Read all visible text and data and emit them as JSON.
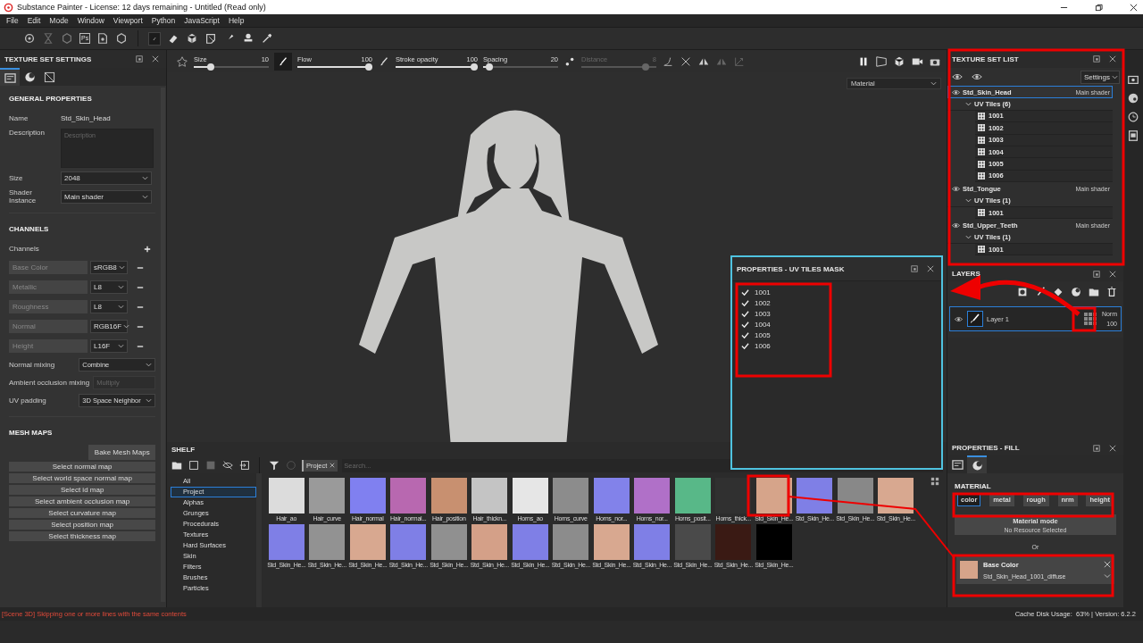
{
  "window": {
    "title": "Substance Painter - License: 12 days remaining - Untitled (Read only)"
  },
  "menu": [
    "File",
    "Edit",
    "Mode",
    "Window",
    "Viewport",
    "Python",
    "JavaScript",
    "Help"
  ],
  "toolbar": {
    "export_badge": "Ps"
  },
  "tool_options": {
    "sliders": [
      {
        "label": "Size",
        "value": "10",
        "level": 0.2,
        "disabled": false
      },
      {
        "label": "Flow",
        "value": "100",
        "level": 1,
        "disabled": false
      },
      {
        "label": "Stroke opacity",
        "value": "100",
        "level": 1,
        "disabled": false
      },
      {
        "label": "Spacing",
        "value": "20",
        "level": 0.04,
        "disabled": false
      },
      {
        "label": "Distance",
        "value": "8",
        "level": 0.9,
        "disabled": true
      }
    ]
  },
  "texture_set_settings": {
    "title": "TEXTURE SET SETTINGS",
    "tabs": [
      {
        "kind": "settings",
        "selected": true
      },
      {
        "kind": "material",
        "selected": false
      },
      {
        "kind": "uv",
        "selected": false
      }
    ],
    "general": {
      "heading": "GENERAL PROPERTIES",
      "name_label": "Name",
      "name_value": "Std_Skin_Head",
      "description_label": "Description",
      "description_placeholder": "Description",
      "size_label": "Size",
      "size_value": "2048",
      "shader_label": "Shader Instance",
      "shader_value": "Main shader"
    },
    "channels": {
      "heading": "CHANNELS",
      "label": "Channels",
      "items": [
        {
          "name": "Base Color",
          "format": "sRGB8"
        },
        {
          "name": "Metallic",
          "format": "L8"
        },
        {
          "name": "Roughness",
          "format": "L8"
        },
        {
          "name": "Normal",
          "format": "RGB16F"
        },
        {
          "name": "Height",
          "format": "L16F"
        }
      ],
      "normal_mixing_label": "Normal mixing",
      "normal_mixing_value": "Combine",
      "ao_mixing_label": "Ambient occlusion mixing",
      "ao_mixing_placeholder": "Multiply",
      "uv_padding_label": "UV padding",
      "uv_padding_value": "3D Space Neighbor"
    },
    "mesh_maps": {
      "heading": "MESH MAPS",
      "bake": "Bake Mesh Maps",
      "buttons": [
        "Select normal map",
        "Select world space normal map",
        "Select id map",
        "Select ambient occlusion map",
        "Select curvature map",
        "Select position map",
        "Select thickness map"
      ]
    }
  },
  "viewport": {
    "mode": "Material"
  },
  "uv_tiles_mask": {
    "title": "PROPERTIES - UV TILES MASK",
    "tiles": [
      {
        "label": "1001",
        "checked": true
      },
      {
        "label": "1002",
        "checked": true
      },
      {
        "label": "1003",
        "checked": true
      },
      {
        "label": "1004",
        "checked": true
      },
      {
        "label": "1005",
        "checked": true
      },
      {
        "label": "1006",
        "checked": true
      }
    ]
  },
  "shelf": {
    "title": "SHELF",
    "filter_tag": "Project",
    "search_placeholder": "Search...",
    "categories": [
      {
        "label": "All",
        "selected": false
      },
      {
        "label": "Project",
        "selected": true
      },
      {
        "label": "Alphas",
        "selected": false
      },
      {
        "label": "Grunges",
        "selected": false
      },
      {
        "label": "Procedurals",
        "selected": false
      },
      {
        "label": "Textures",
        "selected": false
      },
      {
        "label": "Hard Surfaces",
        "selected": false
      },
      {
        "label": "Skin",
        "selected": false
      },
      {
        "label": "Filters",
        "selected": false
      },
      {
        "label": "Brushes",
        "selected": false
      },
      {
        "label": "Particles",
        "selected": false
      }
    ],
    "items": [
      {
        "label": "Hair_ao",
        "color": "#dcdcdc"
      },
      {
        "label": "Hair_curve",
        "color": "#9a9a9a"
      },
      {
        "label": "Hair_normal",
        "color": "#8080f0"
      },
      {
        "label": "Hair_normal...",
        "color": "#b868b0"
      },
      {
        "label": "Hair_position",
        "color": "#c89070"
      },
      {
        "label": "Hair_thickn...",
        "color": "#c4c4c4"
      },
      {
        "label": "Horns_ao",
        "color": "#e6e6e6"
      },
      {
        "label": "Horns_curve",
        "color": "#8c8c8c"
      },
      {
        "label": "Horns_nor...",
        "color": "#8282ea"
      },
      {
        "label": "Horns_nor...",
        "color": "#b070c8"
      },
      {
        "label": "Horns_posit...",
        "color": "#58b888"
      },
      {
        "label": "Horns_thick...",
        "color": "#303030"
      },
      {
        "label": "Std_Skin_He...",
        "color": "#d6a48a"
      },
      {
        "label": "Std_Skin_He...",
        "color": "#7f7fe6"
      },
      {
        "label": "Std_Skin_He...",
        "color": "#888888"
      },
      {
        "label": "Std_Skin_He...",
        "color": "#d8a890"
      },
      {
        "label": "Std_Skin_He...",
        "color": "#7f7fe6"
      },
      {
        "label": "Std_Skin_He...",
        "color": "#929292"
      },
      {
        "label": "Std_Skin_He...",
        "color": "#d8a890"
      },
      {
        "label": "Std_Skin_He...",
        "color": "#7f7fe6"
      },
      {
        "label": "Std_Skin_He...",
        "color": "#909090"
      },
      {
        "label": "Std_Skin_He...",
        "color": "#d4a088"
      },
      {
        "label": "Std_Skin_He...",
        "color": "#7f7fe6"
      },
      {
        "label": "Std_Skin_He...",
        "color": "#8c8c8c"
      },
      {
        "label": "Std_Skin_He...",
        "color": "#d8a890"
      },
      {
        "label": "Std_Skin_He...",
        "color": "#7f7fe6"
      },
      {
        "label": "Std_Skin_He...",
        "color": "#4a4a4a"
      },
      {
        "label": "Std_Skin_He...",
        "color": "#3a1a14"
      },
      {
        "label": "Std_Skin_He...",
        "color": "#000000"
      }
    ]
  },
  "texture_set_list": {
    "title": "TEXTURE SET LIST",
    "settings": "Settings",
    "sets": [
      {
        "name": "Std_Skin_Head",
        "shader": "Main shader",
        "selected": true,
        "children": [
          {
            "label": "UV Tiles (6)",
            "expanded": true,
            "children": [
              {
                "label": "1001"
              },
              {
                "label": "1002"
              },
              {
                "label": "1003"
              },
              {
                "label": "1004"
              },
              {
                "label": "1005"
              },
              {
                "label": "1006"
              }
            ]
          }
        ]
      },
      {
        "name": "Std_Tongue",
        "shader": "Main shader",
        "selected": false,
        "children": [
          {
            "label": "UV Tiles (1)",
            "expanded": true,
            "children": [
              {
                "label": "1001"
              }
            ]
          }
        ]
      },
      {
        "name": "Std_Upper_Teeth",
        "shader": "Main shader",
        "selected": false,
        "children": [
          {
            "label": "UV Tiles (1)",
            "expanded": true,
            "children": [
              {
                "label": "1001"
              }
            ]
          }
        ]
      }
    ]
  },
  "layers": {
    "title": "LAYERS",
    "items": [
      {
        "name": "Layer 1",
        "blend": "Norm",
        "opacity": "100",
        "selected": true
      }
    ]
  },
  "properties_fill": {
    "title": "PROPERTIES - FILL",
    "tabs": [
      {
        "kind": "settings",
        "selected": false
      },
      {
        "kind": "material",
        "selected": true
      }
    ],
    "heading": "MATERIAL",
    "channels": [
      {
        "label": "color",
        "selected": true
      },
      {
        "label": "metal",
        "selected": false
      },
      {
        "label": "rough",
        "selected": false
      },
      {
        "label": "nrm",
        "selected": false
      },
      {
        "label": "height",
        "selected": false
      }
    ],
    "mode_title": "Material mode",
    "mode_value": "No Resource Selected",
    "or": "Or",
    "resource": {
      "title": "Base Color",
      "file": "Std_Skin_Head_1001_diffuse"
    }
  },
  "status_bar": {
    "message": "[Scene 3D] Skipping one or more lines with the same contents",
    "info": "Cache Disk Usage:  63% | Version: 6.2.2"
  }
}
